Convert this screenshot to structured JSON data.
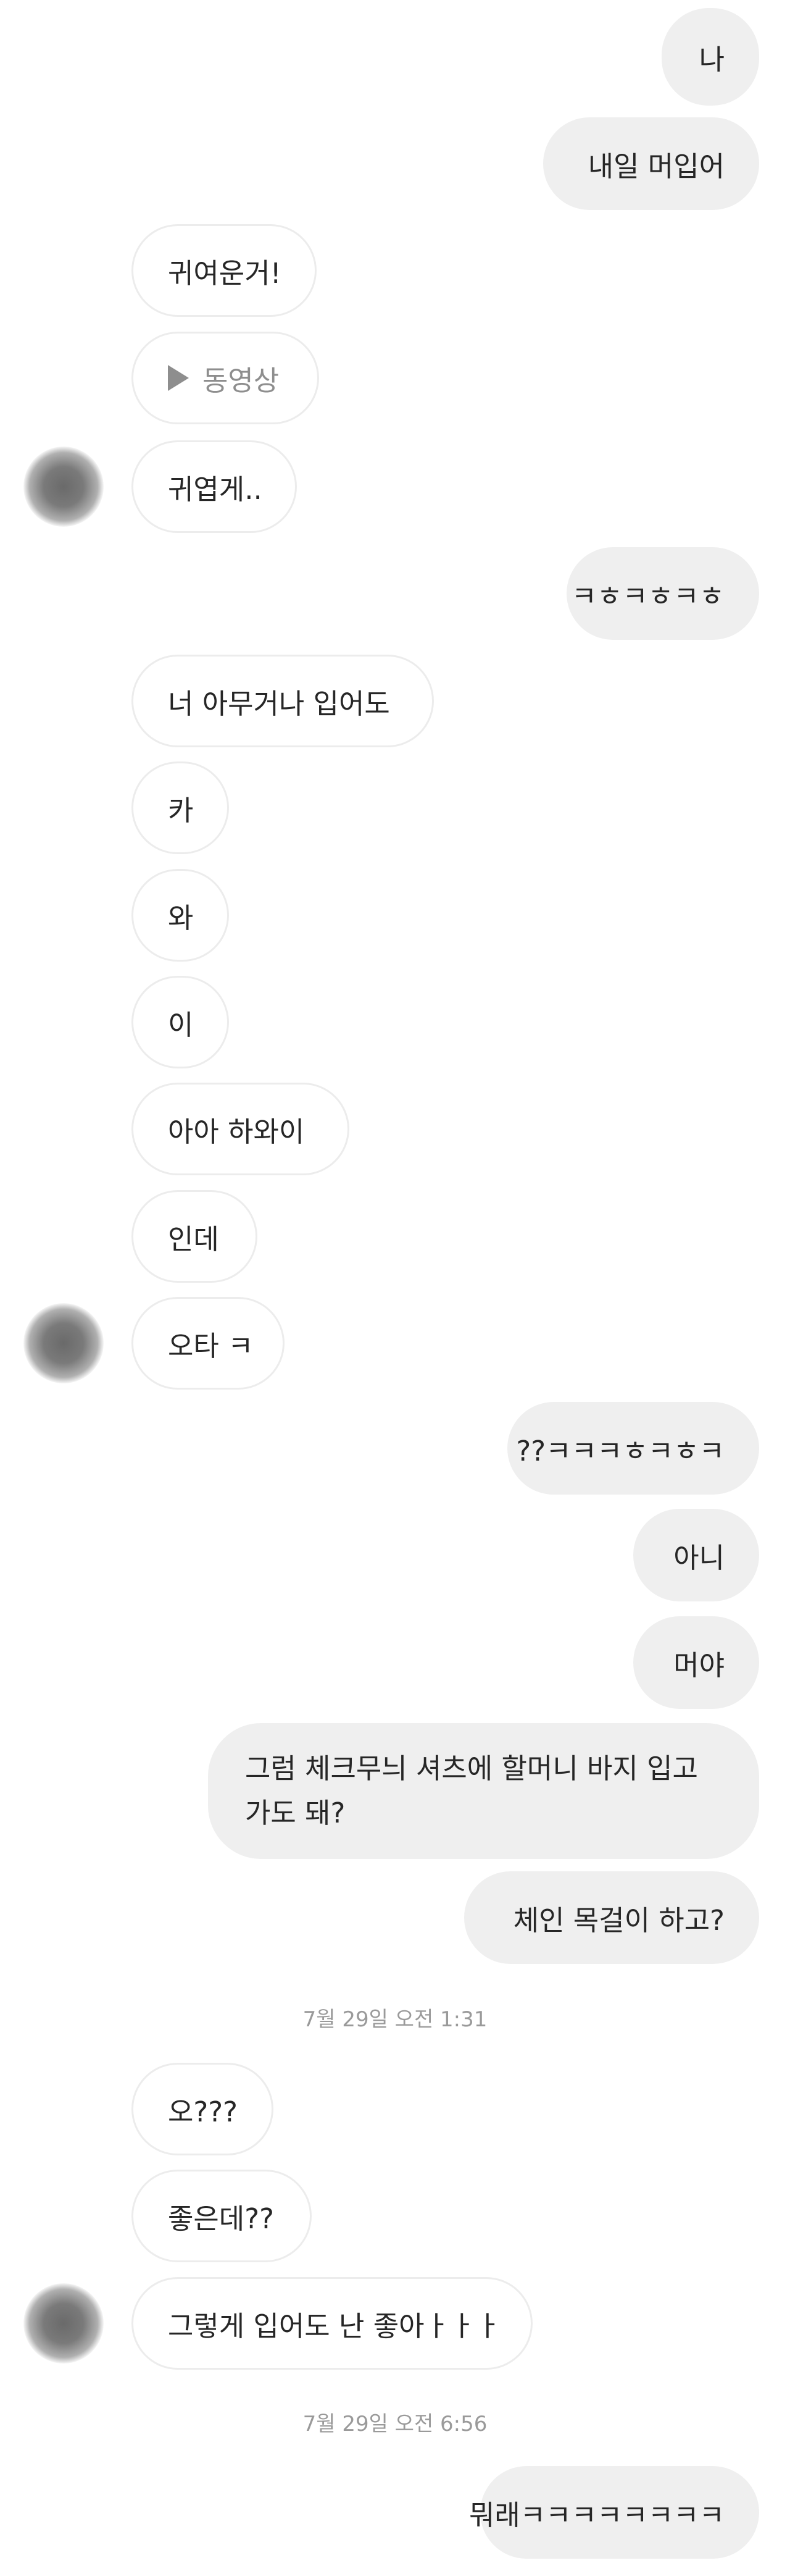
{
  "messages": [
    {
      "side": "me",
      "text": "나"
    },
    {
      "side": "me",
      "text": "내일 머입어"
    },
    {
      "side": "them",
      "text": "귀여운거!"
    },
    {
      "side": "them",
      "text": "동영상",
      "type": "video",
      "icon": "play-icon"
    },
    {
      "side": "them",
      "text": "귀엽게..",
      "avatar": true
    },
    {
      "side": "me",
      "text": "ㅋㅎㅋㅎㅋㅎ"
    },
    {
      "side": "them",
      "text": "너 아무거나 입어도"
    },
    {
      "side": "them",
      "text": "카"
    },
    {
      "side": "them",
      "text": "와"
    },
    {
      "side": "them",
      "text": "이"
    },
    {
      "side": "them",
      "text": "아아 하와이"
    },
    {
      "side": "them",
      "text": "인데"
    },
    {
      "side": "them",
      "text": "오타 ㅋ",
      "avatar": true
    },
    {
      "side": "me",
      "text": "??ㅋㅋㅋㅎㅋㅎㅋ"
    },
    {
      "side": "me",
      "text": "아니"
    },
    {
      "side": "me",
      "text": "머야"
    },
    {
      "side": "me",
      "text": "그럼 체크무늬 셔츠에 할머니 바지 입고 가도 돼?"
    },
    {
      "side": "me",
      "text": "체인 목걸이 하고?"
    },
    {
      "timestamp": "7월 29일 오전 1:31"
    },
    {
      "side": "them",
      "text": "오???"
    },
    {
      "side": "them",
      "text": "좋은데??"
    },
    {
      "side": "them",
      "text": "그렇게 입어도 난 좋아ㅏㅏㅏ",
      "avatar": true
    },
    {
      "timestamp": "7월 29일 오전 6:56"
    },
    {
      "side": "me",
      "text": "뭐래ㅋㅋㅋㅋㅋㅋㅋㅋ"
    }
  ]
}
